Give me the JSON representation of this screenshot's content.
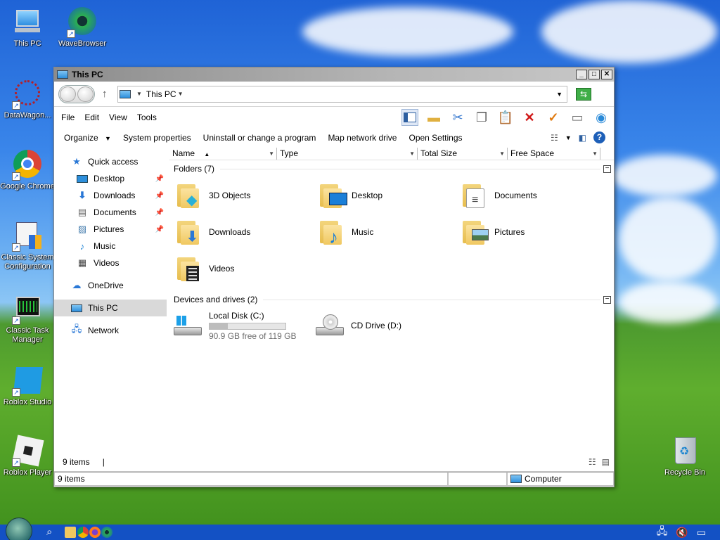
{
  "desktop": {
    "icons": [
      {
        "label": "This PC"
      },
      {
        "label": "WaveBrowser"
      },
      {
        "label": "DataWagon..."
      },
      {
        "label": "Google Chrome"
      },
      {
        "label": "Classic System Configuration"
      },
      {
        "label": "Classic Task Manager"
      },
      {
        "label": "Roblox Studio"
      },
      {
        "label": "Roblox Player"
      },
      {
        "label": "Recycle Bin"
      }
    ]
  },
  "window": {
    "title": "This PC",
    "controls": {
      "minimize": "_",
      "maximize": "□",
      "close": "✕"
    },
    "address": {
      "location": "This PC"
    },
    "menu": {
      "file": "File",
      "edit": "Edit",
      "view": "View",
      "tools": "Tools"
    },
    "commands": {
      "organize": "Organize",
      "system_properties": "System properties",
      "uninstall": "Uninstall or change a program",
      "map_drive": "Map network drive",
      "open_settings": "Open Settings"
    },
    "nav": {
      "quick_access": "Quick access",
      "items": [
        {
          "label": "Desktop"
        },
        {
          "label": "Downloads"
        },
        {
          "label": "Documents"
        },
        {
          "label": "Pictures"
        },
        {
          "label": "Music"
        },
        {
          "label": "Videos"
        }
      ],
      "onedrive": "OneDrive",
      "this_pc": "This PC",
      "network": "Network"
    },
    "columns": {
      "name": "Name",
      "type": "Type",
      "total_size": "Total Size",
      "free_space": "Free Space"
    },
    "folders_header": "Folders (7)",
    "folders": [
      {
        "label": "3D Objects"
      },
      {
        "label": "Desktop"
      },
      {
        "label": "Documents"
      },
      {
        "label": "Downloads"
      },
      {
        "label": "Music"
      },
      {
        "label": "Pictures"
      },
      {
        "label": "Videos"
      }
    ],
    "drives_header": "Devices and drives (2)",
    "drives": {
      "c": {
        "label": "Local Disk (C:)",
        "free_text": "90.9 GB free of 119 GB",
        "used_fraction": 0.24
      },
      "d": {
        "label": "CD Drive (D:)"
      }
    },
    "inner_status": {
      "items": "9 items",
      "sep": "|"
    },
    "statusbar": {
      "items": "9 items",
      "location": "Computer"
    }
  },
  "colors": {
    "accent": "#1351c4",
    "selection": "#d9d9d9",
    "folder": "#f0c860"
  }
}
